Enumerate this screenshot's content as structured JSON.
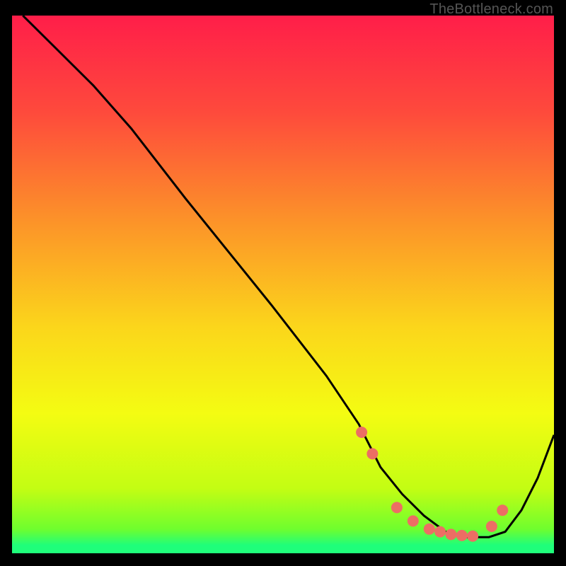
{
  "watermark": "TheBottleneck.com",
  "chart_data": {
    "type": "line",
    "title": "",
    "xlabel": "",
    "ylabel": "",
    "xlim": [
      0,
      100
    ],
    "ylim": [
      0,
      100
    ],
    "grid": false,
    "legend": false,
    "series": [
      {
        "name": "curve",
        "color": "#000000",
        "x": [
          2,
          8,
          15,
          22,
          32,
          40,
          48,
          58,
          64,
          68,
          72,
          76,
          80,
          84,
          88,
          91,
          94,
          97,
          100
        ],
        "y": [
          100,
          94,
          87,
          79,
          66,
          56,
          46,
          33,
          24,
          16,
          11,
          7,
          4,
          3,
          3,
          4,
          8,
          14,
          22
        ]
      }
    ],
    "markers": {
      "name": "bottleneck-points",
      "color": "#EC6E64",
      "x": [
        64.5,
        66.5,
        71,
        74,
        77,
        79,
        81,
        83,
        85,
        88.5,
        90.5
      ],
      "y": [
        22.5,
        18.5,
        8.5,
        6,
        4.5,
        4,
        3.5,
        3.3,
        3.2,
        5,
        8
      ]
    },
    "background_gradient": {
      "stops": [
        {
          "offset": 0.0,
          "color": "#FF1E49"
        },
        {
          "offset": 0.18,
          "color": "#FE4A3C"
        },
        {
          "offset": 0.38,
          "color": "#FC9229"
        },
        {
          "offset": 0.58,
          "color": "#FBD61B"
        },
        {
          "offset": 0.74,
          "color": "#F4FC12"
        },
        {
          "offset": 0.88,
          "color": "#C3FD13"
        },
        {
          "offset": 0.955,
          "color": "#6FFE2E"
        },
        {
          "offset": 0.985,
          "color": "#1FFE7A"
        },
        {
          "offset": 1.0,
          "color": "#1FFE7A"
        }
      ]
    }
  }
}
